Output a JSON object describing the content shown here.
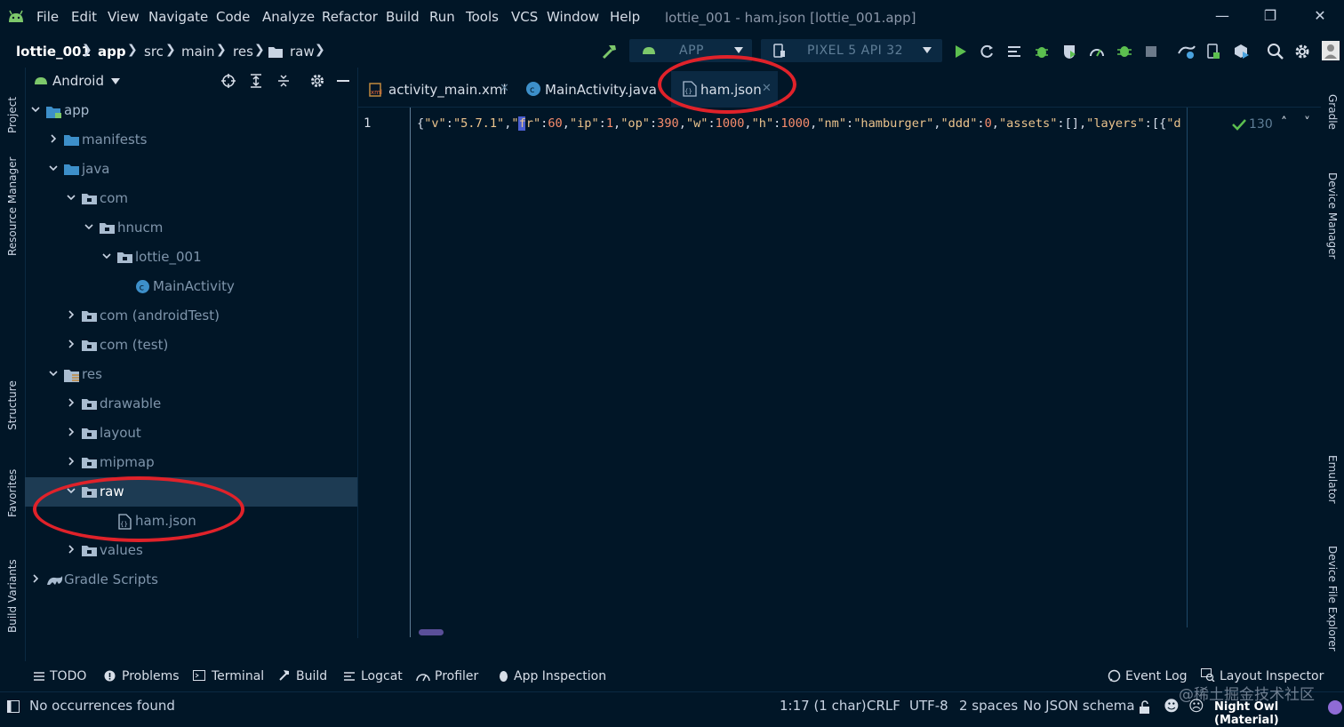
{
  "menu": [
    "File",
    "Edit",
    "View",
    "Navigate",
    "Code",
    "Analyze",
    "Refactor",
    "Build",
    "Run",
    "Tools",
    "VCS",
    "Window",
    "Help"
  ],
  "window_title": "lottie_001 - ham.json [lottie_001.app]",
  "breadcrumbs": [
    "lottie_001",
    "app",
    "src",
    "main",
    "res",
    "raw"
  ],
  "run_config": {
    "app": "APP",
    "device": "PIXEL 5 API 32"
  },
  "left_stripe": [
    "Project",
    "Resource Manager",
    "Structure",
    "Favorites",
    "Build Variants"
  ],
  "right_stripe": [
    "Gradle",
    "Device Manager",
    "Emulator",
    "Device File Explorer"
  ],
  "project": {
    "view_mode": "Android",
    "tree": [
      {
        "label": "app",
        "depth": 0,
        "chevron": "down",
        "icon": "module"
      },
      {
        "label": "manifests",
        "depth": 1,
        "chevron": "right",
        "icon": "folder-blue"
      },
      {
        "label": "java",
        "depth": 1,
        "chevron": "down",
        "icon": "folder-blue"
      },
      {
        "label": "com",
        "depth": 2,
        "chevron": "down",
        "icon": "package"
      },
      {
        "label": "hnucm",
        "depth": 3,
        "chevron": "down",
        "icon": "package"
      },
      {
        "label": "lottie_001",
        "depth": 4,
        "chevron": "down",
        "icon": "package"
      },
      {
        "label": "MainActivity",
        "depth": 5,
        "chevron": "none",
        "icon": "class"
      },
      {
        "label": "com (androidTest)",
        "depth": 2,
        "chevron": "right",
        "icon": "package"
      },
      {
        "label": "com (test)",
        "depth": 2,
        "chevron": "right",
        "icon": "package"
      },
      {
        "label": "res",
        "depth": 1,
        "chevron": "down",
        "icon": "res"
      },
      {
        "label": "drawable",
        "depth": 2,
        "chevron": "right",
        "icon": "package"
      },
      {
        "label": "layout",
        "depth": 2,
        "chevron": "right",
        "icon": "package"
      },
      {
        "label": "mipmap",
        "depth": 2,
        "chevron": "right",
        "icon": "package"
      },
      {
        "label": "raw",
        "depth": 2,
        "chevron": "down",
        "icon": "package",
        "selected": true
      },
      {
        "label": "ham.json",
        "depth": 4,
        "chevron": "none",
        "icon": "json"
      },
      {
        "label": "values",
        "depth": 2,
        "chevron": "right",
        "icon": "package"
      },
      {
        "label": "Gradle Scripts",
        "depth": 0,
        "chevron": "right",
        "icon": "gradle"
      }
    ]
  },
  "editor": {
    "tabs": [
      {
        "label": "activity_main.xml",
        "icon": "xml"
      },
      {
        "label": "MainActivity.java",
        "icon": "class"
      },
      {
        "label": "ham.json",
        "icon": "json",
        "active": true
      }
    ],
    "line_number": "1",
    "code": "{\"v\":\"5.7.1\",\"fr\":60,\"ip\":1,\"op\":390,\"w\":1000,\"h\":1000,\"nm\":\"hamburger\",\"ddd\":0,\"assets\":[],\"layers\":[{\"d",
    "inspection_count": "130"
  },
  "bottom_tabs": [
    "TODO",
    "Problems",
    "Terminal",
    "Build",
    "Logcat",
    "Profiler",
    "App Inspection"
  ],
  "bottom_tabs_right": [
    "Event Log",
    "Layout Inspector"
  ],
  "status": {
    "message": "No occurrences found",
    "position": "1:17 (1 char)",
    "line_sep": "CRLF",
    "encoding": "UTF-8",
    "indent": "2 spaces",
    "schema": "No JSON schema",
    "theme": "Night Owl (Material)",
    "watermark": "@稀土掘金技术社区"
  },
  "colors": {
    "bg": "#011627",
    "selection": "#1d3b53",
    "string": "#ecc48d",
    "number": "#f78c6c",
    "accent_green": "#7dc86b",
    "annotation": "#e0222a"
  }
}
